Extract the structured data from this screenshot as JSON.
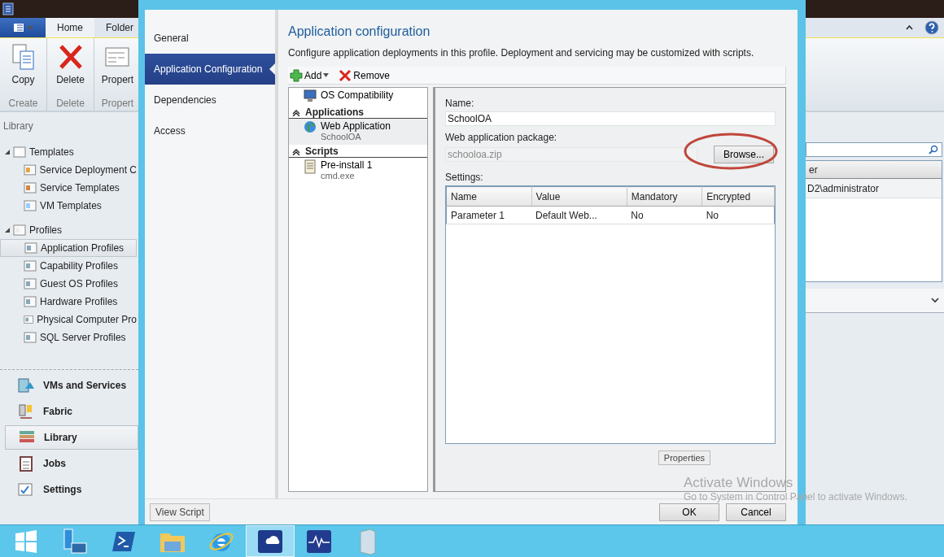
{
  "app": {
    "ribbon_tabs": [
      {
        "label": "Home",
        "selected": true
      },
      {
        "label": "Folder",
        "selected": false
      }
    ],
    "ribbon_groups": [
      {
        "label": "Create",
        "button": {
          "kind": "copy",
          "label": "Copy"
        }
      },
      {
        "label": "Delete",
        "button": {
          "kind": "delete",
          "label": "Delete"
        }
      },
      {
        "label": "Propert",
        "button": {
          "kind": "properties",
          "label": "Propert"
        }
      }
    ],
    "library_title": "Library",
    "tree": [
      {
        "label": "Templates",
        "kind": "templates",
        "expanded": true,
        "children": [
          {
            "label": "Service Deployment C",
            "kind": "deploy",
            "selected": false
          },
          {
            "label": "Service Templates",
            "kind": "service",
            "selected": false
          },
          {
            "label": "VM Templates",
            "kind": "vm",
            "selected": false
          }
        ]
      },
      {
        "label": "Profiles",
        "kind": "profiles",
        "expanded": true,
        "children": [
          {
            "label": "Application Profiles",
            "kind": "profile",
            "selected": true
          },
          {
            "label": "Capability Profiles",
            "kind": "profile",
            "selected": false
          },
          {
            "label": "Guest OS Profiles",
            "kind": "profile",
            "selected": false
          },
          {
            "label": "Hardware Profiles",
            "kind": "profile",
            "selected": false
          },
          {
            "label": "Physical Computer Pro",
            "kind": "profile",
            "selected": false
          },
          {
            "label": "SQL Server Profiles",
            "kind": "profile",
            "selected": false
          }
        ]
      }
    ],
    "workspaces": [
      {
        "label": "VMs and Services",
        "kind": "vms",
        "selected": false
      },
      {
        "label": "Fabric",
        "kind": "fabric",
        "selected": false
      },
      {
        "label": "Library",
        "kind": "library",
        "selected": true
      },
      {
        "label": "Jobs",
        "kind": "jobs",
        "selected": false
      },
      {
        "label": "Settings",
        "kind": "settings",
        "selected": false
      }
    ],
    "table": {
      "column_1": "er",
      "rows": [
        "D2\\administrator"
      ]
    }
  },
  "dialog": {
    "nav": [
      {
        "label": "General",
        "selected": false
      },
      {
        "label": "Application Configuration",
        "selected": true
      },
      {
        "label": "Dependencies",
        "selected": false
      },
      {
        "label": "Access",
        "selected": false
      }
    ],
    "heading": "Application configuration",
    "description": "Configure application deployments in this profile. Deployment and servicing may be customized with scripts.",
    "toolbar": [
      {
        "kind": "add",
        "label": "Add"
      },
      {
        "kind": "remove",
        "label": "Remove"
      }
    ],
    "items": [
      {
        "kind": "compatibility",
        "label": "OS Compatibility",
        "selected": false
      },
      {
        "kind": "section",
        "label": "Applications",
        "expanded": true
      },
      {
        "kind": "application",
        "label": "Web Application",
        "sub": "SchoolOA",
        "selected": true
      },
      {
        "kind": "section",
        "label": "Scripts",
        "expanded": true
      },
      {
        "kind": "script",
        "label": "Pre-install 1",
        "sub": "cmd.exe",
        "selected": false
      }
    ],
    "name_label": "Name:",
    "name_value": "SchoolOA",
    "package_label": "Web application package:",
    "package_value": "schooloa.zip",
    "browse": "Browse...",
    "settings_label": "Settings:",
    "columns": [
      "Name",
      "Value",
      "Mandatory",
      "Encrypted"
    ],
    "rows": [
      [
        "Parameter 1",
        "Default Web...",
        "No",
        "No"
      ]
    ],
    "properties": "Properties",
    "view_script": "View Script",
    "ok": "OK",
    "cancel": "Cancel"
  },
  "activation": {
    "title": "Activate Windows",
    "message": "Go to System in Control Panel to activate Windows."
  },
  "taskbar": [
    {
      "kind": "start",
      "selected": false
    },
    {
      "kind": "server",
      "selected": false
    },
    {
      "kind": "shell",
      "selected": false
    },
    {
      "kind": "folder",
      "selected": false
    },
    {
      "kind": "browser",
      "selected": false
    },
    {
      "kind": "vmm",
      "selected": true
    },
    {
      "kind": "monitor",
      "selected": false
    },
    {
      "kind": "tower",
      "selected": false
    }
  ]
}
